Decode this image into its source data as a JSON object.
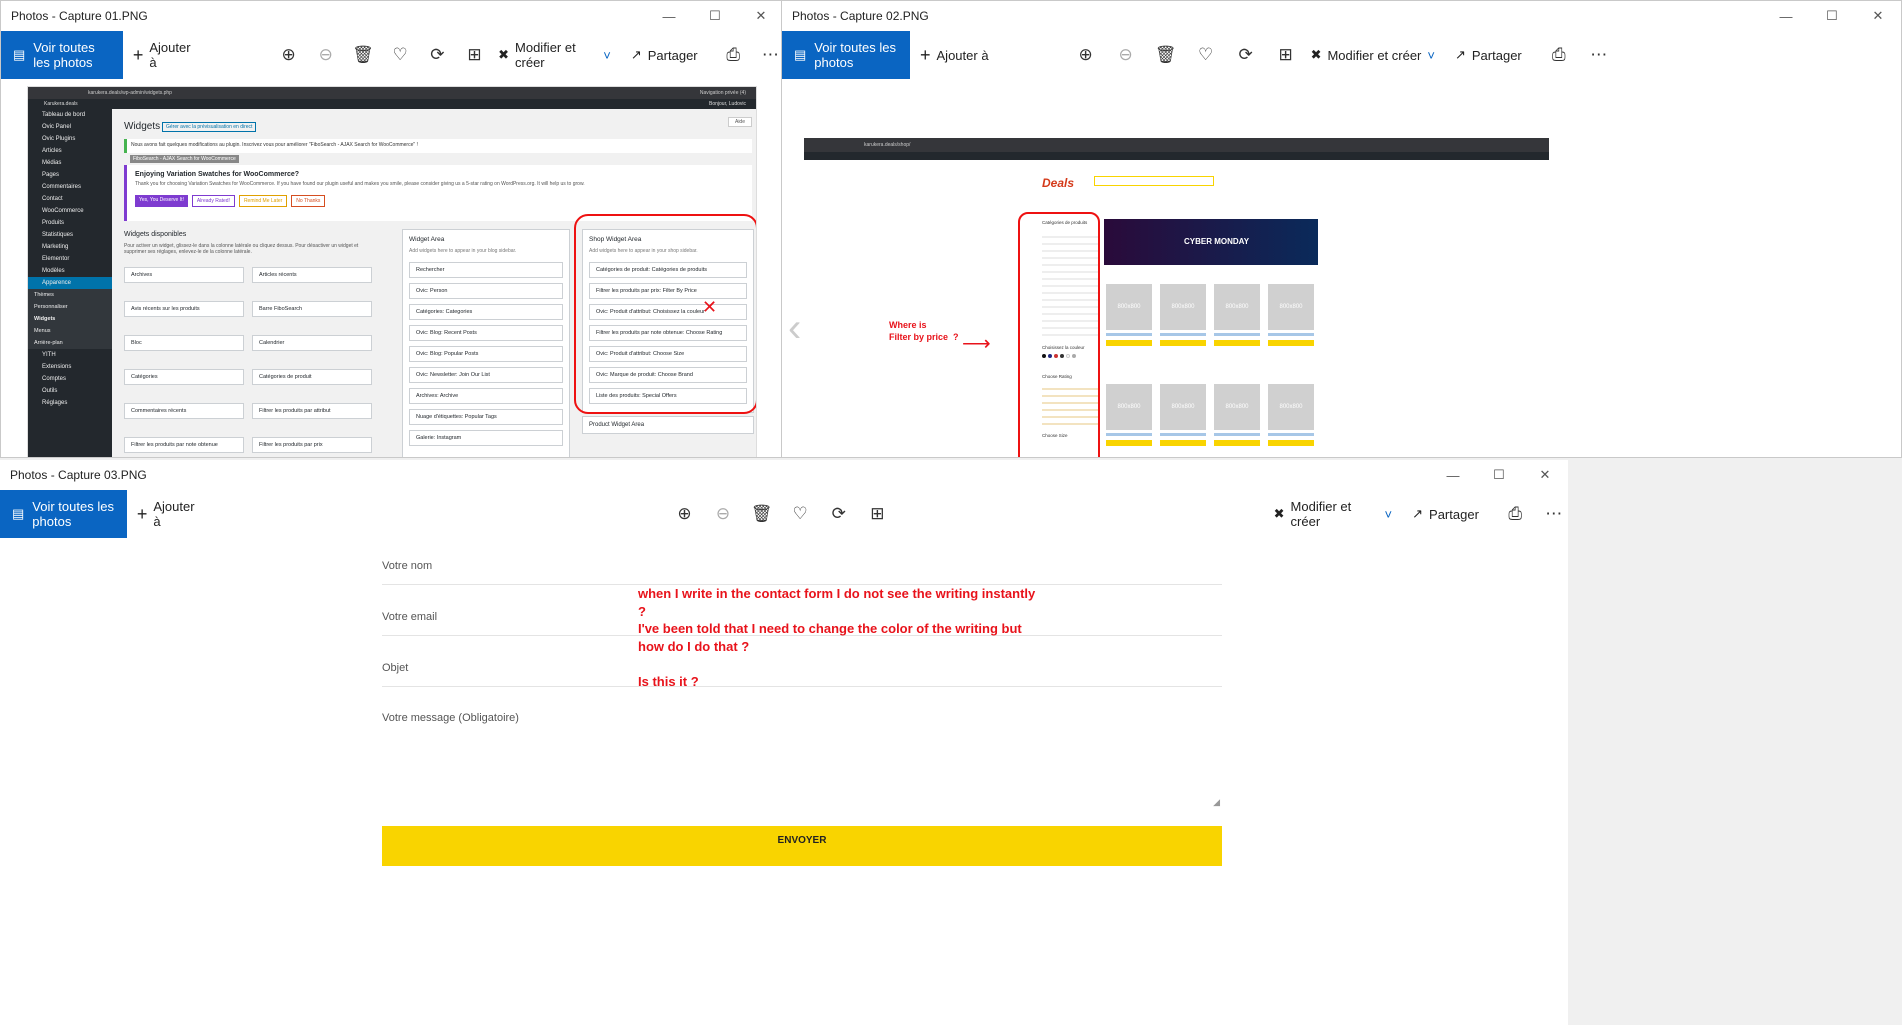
{
  "window1": {
    "title": "Photos - Capture 01.PNG",
    "toolbar": {
      "see_all": "Voir toutes les photos",
      "add_to": "Ajouter à",
      "edit_create": "Modifier et créer",
      "share": "Partager"
    }
  },
  "window2": {
    "title": "Photos - Capture 02.PNG",
    "toolbar": {
      "see_all": "Voir toutes les photos",
      "add_to": "Ajouter à",
      "edit_create": "Modifier et créer",
      "share": "Partager"
    }
  },
  "window3": {
    "title": "Photos - Capture 03.PNG",
    "toolbar": {
      "see_all": "Voir toutes les photos",
      "add_to": "Ajouter à",
      "edit_create": "Modifier et créer",
      "share": "Partager"
    }
  },
  "wp": {
    "url": "karukera.deals/wp-admin/widgets.php",
    "site": "Karukera.deals",
    "user": "Bonjour, Ludovic",
    "private": "Navigation privée (4)",
    "sidebar": [
      "Tableau de bord",
      "Ovic Panel",
      "Ovic Plugins",
      "Articles",
      "Médias",
      "Pages",
      "Commentaires",
      "Contact",
      "WooCommerce",
      "Produits",
      "Statistiques",
      "Marketing",
      "Elementor",
      "Modèles",
      "Apparence",
      "Thèmes",
      "Personnaliser",
      "Widgets",
      "Menus",
      "Arrière-plan",
      "YITH",
      "Extensions",
      "Comptes",
      "Outils",
      "Réglages"
    ],
    "page_title": "Widgets",
    "manage_btn": "Gérer avec la prévisualisation en direct",
    "notice": "Nous avons fait quelques modifications au plugin. Inscrivez vous pour améliorer \"FiboSearch - AJAX Search for WooCommerce\" !",
    "notice_tag": "FiboSearch - AJAX Search for WooCommerce",
    "promo_title": "Enjoying Variation Swatches for WooCommerce?",
    "promo_text": "Thank you for choosing Variation Swatches for WooCommerce. If you have found our plugin useful and makes you smile, please consider giving us a 5-star rating on WordPress.org. It will help us to grow.",
    "promo_buttons": [
      "Yes, You Deserve It!",
      "Already Rated!",
      "Remind Me Later",
      "No Thanks"
    ],
    "available_title": "Widgets disponibles",
    "available_desc": "Pour activer un widget, glissez-le dans la colonne latérale ou cliquez dessus. Pour désactiver un widget et supprimer ses réglages, enlevez-le de la colonne latérale.",
    "available": [
      "Archives",
      "Articles récents",
      "Avis récents sur les produits",
      "Barre FiboSearch",
      "Bloc",
      "Calendrier",
      "Catégories",
      "Catégories de produit",
      "Commentaires récents",
      "Filtrer les produits par attribut",
      "Filtrer les produits par note obtenue",
      "Filtrer les produits par prix"
    ],
    "widget_area_title": "Widget Area",
    "widget_area_desc": "Add widgets here to appear in your blog sidebar.",
    "widget_area": [
      "Rechercher",
      "Ovic: Person",
      "Catégories: Categories",
      "Ovic: Blog: Recent Posts",
      "Ovic: Blog: Popular Posts",
      "Ovic: Newsletter: Join Our List",
      "Archives: Archive",
      "Nuage d'étiquettes: Popular Tags",
      "Galerie: Instagram"
    ],
    "shop_area_title": "Shop Widget Area",
    "shop_area_desc": "Add widgets here to appear in your shop sidebar.",
    "shop_area": [
      "Catégories de produit: Catégories de produits",
      "Filtrer les produits par prix: Filter By Price",
      "Ovic: Produit d'attribut: Choisissez la couleur",
      "Filtrer les produits par note obtenue: Choose Rating",
      "Ovic: Produit d'attribut: Choose Size",
      "Ovic: Marque de produit: Choose Brand",
      "Liste des produits: Special Offers"
    ],
    "product_area_title": "Product Widget Area",
    "screen_options": "Aide"
  },
  "shop": {
    "url": "karukera.deals/shop/",
    "logo": "Deals",
    "banner": "CYBER MONDAY",
    "categories_title": "Catégories de produits",
    "color_title": "Choisissez la couleur",
    "rating_title": "Choose Rating",
    "size_title": "Choose Size",
    "placeholder": "800x800",
    "annotation": "Where is\nFilter by price  ?"
  },
  "contact": {
    "fields": [
      "Votre nom",
      "Votre email",
      "Objet",
      "Votre message (Obligatoire)"
    ],
    "submit": "ENVOYER",
    "annotation_lines": [
      "when I write in the contact form I do not see the writing instantly",
      "?",
      "I've been told that I need to change the color of the writing but",
      "how do I do that  ?",
      "",
      "Is this it  ?"
    ]
  },
  "colors": {
    "accent": "#0a65c2",
    "red": "#e8131b",
    "yellow": "#f9d400"
  }
}
